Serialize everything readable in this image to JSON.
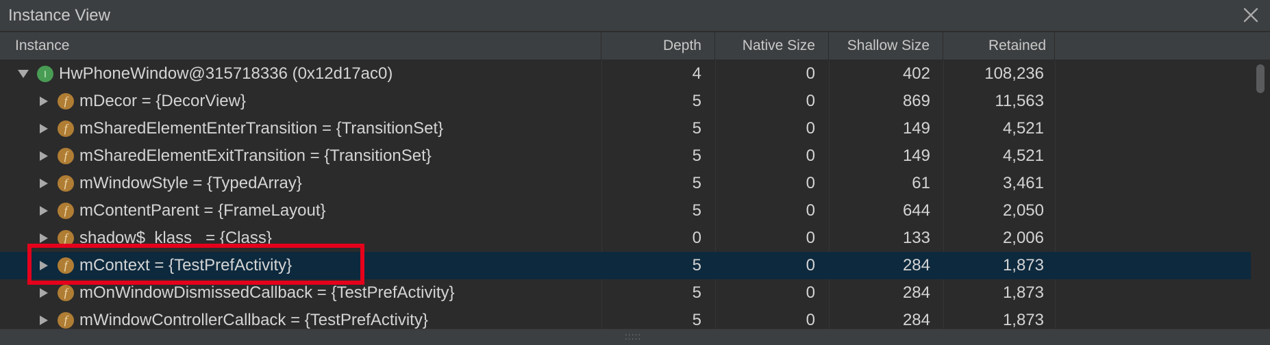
{
  "window": {
    "title": "Instance View"
  },
  "columns": [
    {
      "label": "Instance"
    },
    {
      "label": "Depth"
    },
    {
      "label": "Native Size"
    },
    {
      "label": "Shallow Size"
    },
    {
      "label": "Retained Size",
      "sort": "▼"
    }
  ],
  "rows": [
    {
      "badge": "I",
      "kind": "instance",
      "expanded": true,
      "name": "HwPhoneWindow@315718336 (0x12d17ac0)",
      "depth": "4",
      "native": "0",
      "shallow": "402",
      "retained": "108,236"
    },
    {
      "badge": "f",
      "kind": "field",
      "name": "mDecor = {DecorView}",
      "depth": "5",
      "native": "0",
      "shallow": "869",
      "retained": "11,563"
    },
    {
      "badge": "f",
      "kind": "field",
      "name": "mSharedElementEnterTransition = {TransitionSet}",
      "depth": "5",
      "native": "0",
      "shallow": "149",
      "retained": "4,521"
    },
    {
      "badge": "f",
      "kind": "field",
      "name": "mSharedElementExitTransition = {TransitionSet}",
      "depth": "5",
      "native": "0",
      "shallow": "149",
      "retained": "4,521"
    },
    {
      "badge": "f",
      "kind": "field",
      "name": "mWindowStyle = {TypedArray}",
      "depth": "5",
      "native": "0",
      "shallow": "61",
      "retained": "3,461"
    },
    {
      "badge": "f",
      "kind": "field",
      "name": "mContentParent = {FrameLayout}",
      "depth": "5",
      "native": "0",
      "shallow": "644",
      "retained": "2,050"
    },
    {
      "badge": "f",
      "kind": "field",
      "name": "shadow$_klass_ = {Class}",
      "depth": "0",
      "native": "0",
      "shallow": "133",
      "retained": "2,006"
    },
    {
      "badge": "f",
      "kind": "field",
      "name": "mContext = {TestPrefActivity}",
      "depth": "5",
      "native": "0",
      "shallow": "284",
      "retained": "1,873",
      "selected": true
    },
    {
      "badge": "f",
      "kind": "field",
      "name": "mOnWindowDismissedCallback = {TestPrefActivity}",
      "depth": "5",
      "native": "0",
      "shallow": "284",
      "retained": "1,873"
    },
    {
      "badge": "f",
      "kind": "field",
      "name": "mWindowControllerCallback = {TestPrefActivity}",
      "depth": "5",
      "native": "0",
      "shallow": "284",
      "retained": "1,873"
    }
  ],
  "colors": {
    "selected_row": "#0d293e",
    "highlight_box": "#e5001c",
    "instance_badge": "#499c54",
    "field_badge": "#b07d34"
  },
  "icons": {
    "close": "close-icon",
    "expanded": "triangle-down-icon",
    "collapsed": "triangle-right-icon",
    "resize": "resize-grip-icon"
  }
}
